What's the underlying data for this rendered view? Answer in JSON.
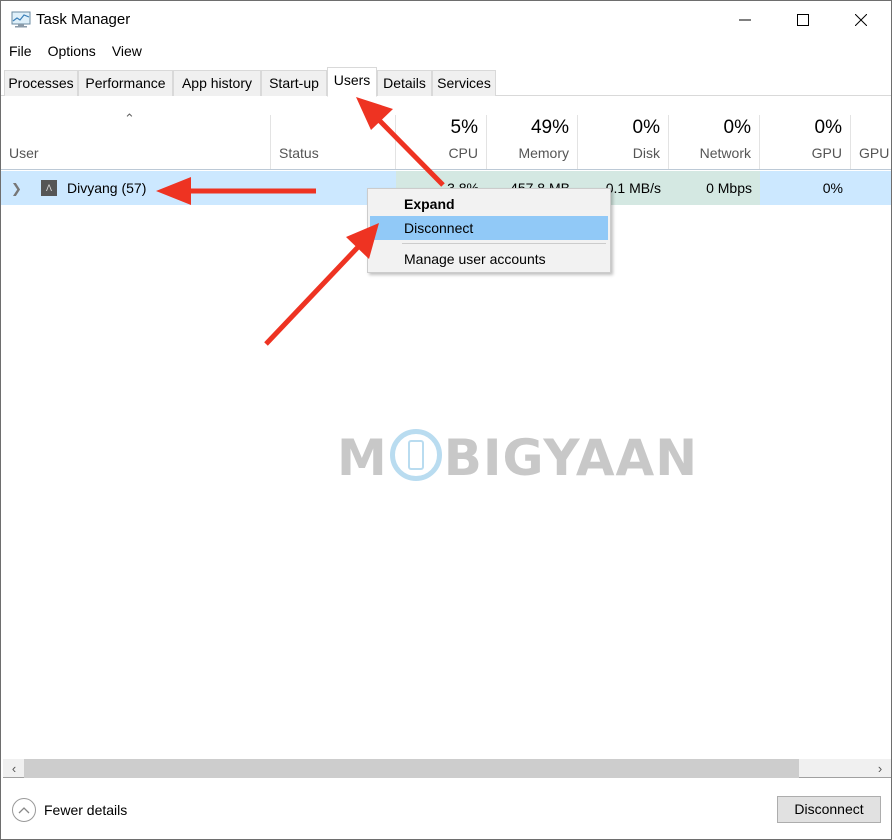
{
  "window": {
    "title": "Task Manager",
    "controls": {
      "minimize": "minimize",
      "maximize": "maximize",
      "close": "close"
    }
  },
  "menu": [
    "File",
    "Options",
    "View"
  ],
  "tabs": [
    {
      "label": "Processes",
      "active": false
    },
    {
      "label": "Performance",
      "active": false
    },
    {
      "label": "App history",
      "active": false
    },
    {
      "label": "Start-up",
      "active": false
    },
    {
      "label": "Users",
      "active": true
    },
    {
      "label": "Details",
      "active": false
    },
    {
      "label": "Services",
      "active": false
    }
  ],
  "columns": [
    {
      "label": "User",
      "percent": ""
    },
    {
      "label": "Status",
      "percent": ""
    },
    {
      "label": "CPU",
      "percent": "5%"
    },
    {
      "label": "Memory",
      "percent": "49%"
    },
    {
      "label": "Disk",
      "percent": "0%"
    },
    {
      "label": "Network",
      "percent": "0%"
    },
    {
      "label": "GPU",
      "percent": "0%"
    },
    {
      "label": "GPU e",
      "percent": ""
    }
  ],
  "rows": [
    {
      "user": "Divyang (57)",
      "status": "",
      "cpu": "3.8%",
      "memory": "457.8 MB",
      "disk": "0.1 MB/s",
      "network": "0 Mbps",
      "gpu": "0%",
      "gpu_engine": ""
    }
  ],
  "context_menu": {
    "items": [
      {
        "label": "Expand",
        "bold": true,
        "highlighted": false
      },
      {
        "label": "Disconnect",
        "bold": false,
        "highlighted": true
      },
      {
        "label": "Manage user accounts",
        "bold": false,
        "highlighted": false
      }
    ]
  },
  "watermark": {
    "prefix": "M",
    "suffix": "BIGYAAN"
  },
  "footer": {
    "fewer_details": "Fewer details",
    "disconnect_button": "Disconnect"
  },
  "colors": {
    "selection": "#cce8ff",
    "heat": "#d4e8e2",
    "menu_highlight": "#91c9f7",
    "annotation_arrow": "#ee3322"
  }
}
